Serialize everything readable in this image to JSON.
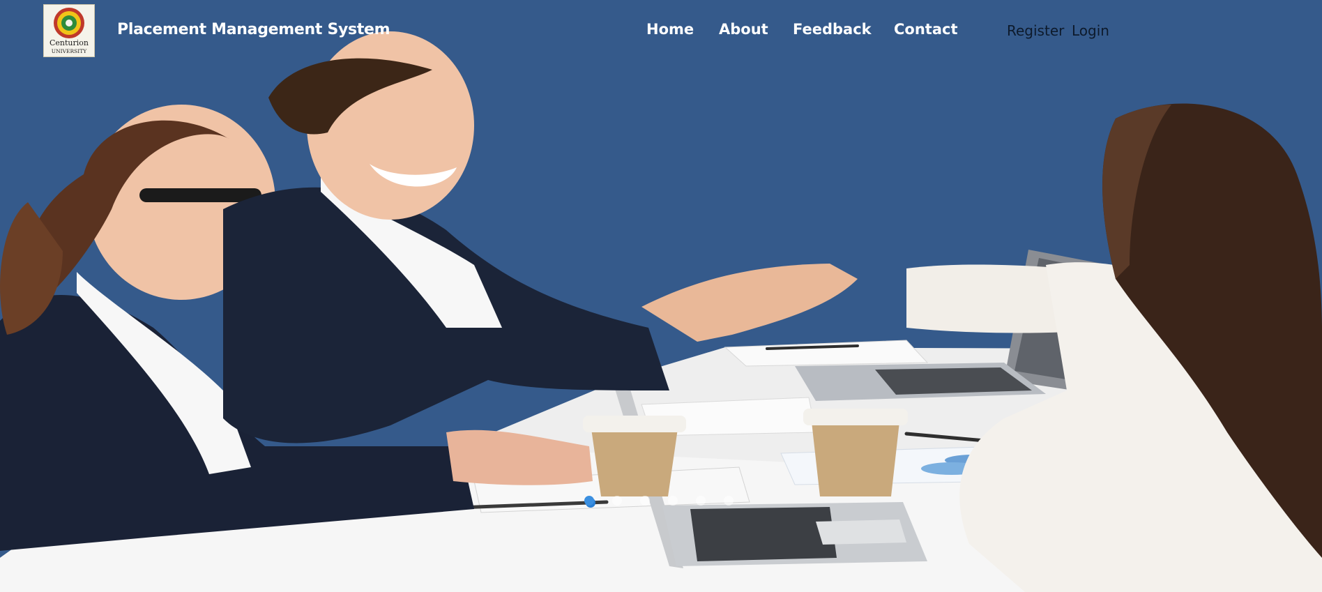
{
  "header": {
    "logo": {
      "line1": "Centurion",
      "line2": "UNIVERSITY"
    },
    "brand_title": "Placement Management System",
    "nav": [
      {
        "label": "Home"
      },
      {
        "label": "About"
      },
      {
        "label": "Feedback"
      },
      {
        "label": "Contact"
      }
    ],
    "auth": [
      {
        "label": "Register"
      },
      {
        "label": "Login"
      }
    ]
  },
  "hero": {
    "image": "business-handshake-interview-photo",
    "slides_total": 6,
    "active_slide": 1
  },
  "colors": {
    "background": "#355a8b",
    "active_dot": "#3b8fe0",
    "nav_text": "#ffffff",
    "auth_text": "#0d1a2b"
  }
}
